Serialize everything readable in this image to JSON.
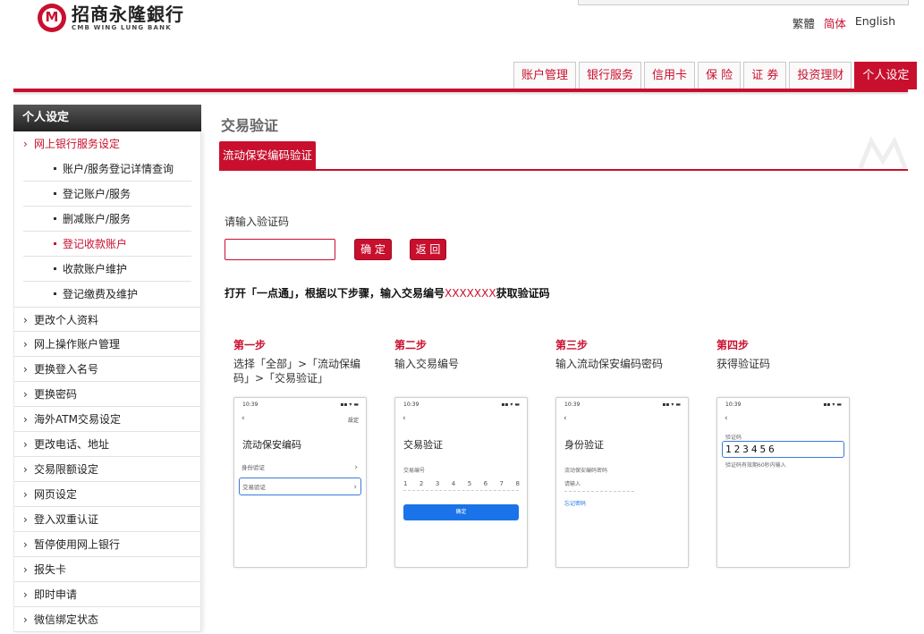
{
  "brand": {
    "name_cn": "招商永隆銀行",
    "name_en": "CMB WING LUNG BANK"
  },
  "colors": {
    "accent": "#c8102e",
    "link_blue": "#1a73e8"
  },
  "lang": {
    "trad": "繁體",
    "simp": "简体",
    "en": "English",
    "active": "简体"
  },
  "nav": {
    "tabs": [
      "账户管理",
      "银行服务",
      "信用卡",
      "保 险",
      "证 券",
      "投资理财",
      "个人设定"
    ],
    "active": "个人设定"
  },
  "sidebar": {
    "title": "个人设定",
    "expanded_label": "网上银行服务设定",
    "sub_items": [
      {
        "label": "账户/服务登记详情查询"
      },
      {
        "label": "登记账户/服务"
      },
      {
        "label": "删减账户/服务"
      },
      {
        "label": "登记收款账户"
      },
      {
        "label": "收款账户维护"
      },
      {
        "label": "登记缴费及维护"
      }
    ],
    "active_sub": "登记收款账户",
    "items": [
      {
        "label": "更改个人资料"
      },
      {
        "label": "网上操作账户管理"
      },
      {
        "label": "更换登入名号"
      },
      {
        "label": "更换密码"
      },
      {
        "label": "海外ATM交易设定"
      },
      {
        "label": "更改电话、地址"
      },
      {
        "label": "交易限额设定"
      },
      {
        "label": "网页设定"
      },
      {
        "label": "登入双重认证"
      },
      {
        "label": "暂停使用网上银行"
      },
      {
        "label": "报失卡"
      },
      {
        "label": "即时申请"
      },
      {
        "label": "微信绑定状态"
      }
    ]
  },
  "main": {
    "title": "交易验证",
    "subtab": "流动保安编码验证",
    "prompt": "请输入验证码",
    "input_value": "",
    "confirm_btn": "确 定",
    "back_btn": "返 回",
    "instruction_pre": "打开「一点通」，根据以下步骤，输入交易编号",
    "instruction_code": "XXXXXXX",
    "instruction_post": "获取验证码"
  },
  "steps": [
    {
      "heading": "第一步",
      "desc": "选择「全部」>「流动保编码」>「交易验证」"
    },
    {
      "heading": "第二步",
      "desc": "输入交易编号"
    },
    {
      "heading": "第三步",
      "desc": "输入流动保安编码密码"
    },
    {
      "heading": "第四步",
      "desc": "获得验证码"
    }
  ],
  "phones": {
    "time": "10:39",
    "p1": {
      "title": "流动保安编码",
      "right": "設定",
      "row1": "身份验证",
      "row2": "交易验证"
    },
    "p2": {
      "title": "交易验证",
      "field_label": "交易编号",
      "digits": [
        "1",
        "2",
        "3",
        "4",
        "5",
        "6",
        "7",
        "8"
      ],
      "button": "确定"
    },
    "p3": {
      "title": "身份验证",
      "field_label": "流动保安编码密码",
      "placeholder": "请输入",
      "link": "忘记密码"
    },
    "p4": {
      "field_label": "验证码",
      "code": "123456",
      "note": "验证码有效期60秒内输入"
    }
  }
}
